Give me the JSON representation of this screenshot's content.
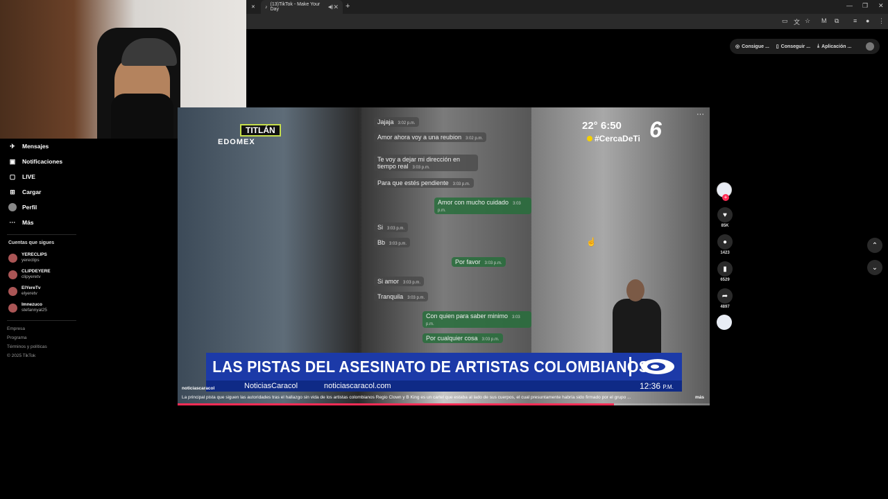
{
  "browser": {
    "tab_title": "(13)TikTok - Make Your Day",
    "new_tab": "+",
    "bookmarks": [
      "Consigue ...",
      "Conseguir ...",
      "Aplicación ..."
    ]
  },
  "sidebar": {
    "items": [
      {
        "label": "Mensajes",
        "icon": "paper-plane-icon"
      },
      {
        "label": "Notificaciones",
        "icon": "inbox-icon"
      },
      {
        "label": "LIVE",
        "icon": "live-icon"
      },
      {
        "label": "Cargar",
        "icon": "upload-icon"
      },
      {
        "label": "Perfil",
        "icon": "avatar"
      },
      {
        "label": "Más",
        "icon": "more-icon"
      }
    ],
    "following_title": "Cuentas que sigues",
    "following": [
      {
        "name": "YERECLIPS",
        "user": "yereclips"
      },
      {
        "name": "CLIPDEYERE",
        "user": "clipyeretv"
      },
      {
        "name": "ElYereTv",
        "user": "elyeretv"
      },
      {
        "name": "Imnezuco",
        "user": "stefannyal25"
      }
    ],
    "footer": [
      "Empresa",
      "Programa",
      "Términos y políticas",
      "© 2025 TikTok"
    ]
  },
  "video": {
    "location": "TITLÁN",
    "location_sub": "EDOMEX",
    "temp_time": "22°  6:50",
    "hashtag": "#CercaDeTi",
    "channel_logo": "6",
    "menu": "···",
    "chat": [
      {
        "text": "Jajaja",
        "time": "3:02 p.m.",
        "dir": "in"
      },
      {
        "text": "Amor ahora voy a una reubion",
        "time": "3:02 p.m.",
        "dir": "in"
      },
      {
        "text": "Te voy a dejar mi dirección en tiempo real",
        "time": "3:03 p.m.",
        "dir": "in"
      },
      {
        "text": "Para que estés pendiente",
        "time": "3:03 p.m.",
        "dir": "in"
      },
      {
        "text": "Amor con mucho cuidado",
        "time": "3:03 p.m.",
        "dir": "out"
      },
      {
        "text": "Si",
        "time": "3:03 p.m.",
        "dir": "in"
      },
      {
        "text": "Bb",
        "time": "3:03 p.m.",
        "dir": "in"
      },
      {
        "text": "Por favor",
        "time": "3:03 p.m.",
        "dir": "out"
      },
      {
        "text": "Si amor",
        "time": "3:03 p.m.",
        "dir": "in"
      },
      {
        "text": "Tranquila",
        "time": "3:03 p.m.",
        "dir": "in"
      },
      {
        "text": "Con quien para saber minimo",
        "time": "3:03 p.m.",
        "dir": "out"
      },
      {
        "text": "Por cualquier cosa",
        "time": "3:03 p.m.",
        "dir": "out"
      }
    ],
    "headline": "LAS PISTAS DEL ASESINATO DE ARTISTAS COLOMBIANOS",
    "brand1": "NoticiasCaracol",
    "brand2": "noticiascaracol.com",
    "clock": "12:36",
    "clock_suffix": "P.M.",
    "caption_user": "noticiascaracol",
    "caption": "La principal pista que siguen las autoridades tras el hallazgo sin vida de los artistas colombianos Regio Clown y B King es un cartel que estaba al lado de sus cuerpos, el cual presuntamente habría sido firmado por el grupo ...",
    "caption_more": "más",
    "progress": 0.82
  },
  "actions": {
    "likes": "85K",
    "comments": "1423",
    "saves": "6529",
    "shares": "4897"
  },
  "colors": {
    "accent": "#fe2c55",
    "headline_bg": "#1c3aa8",
    "tv_badge": "#c7e04a"
  }
}
